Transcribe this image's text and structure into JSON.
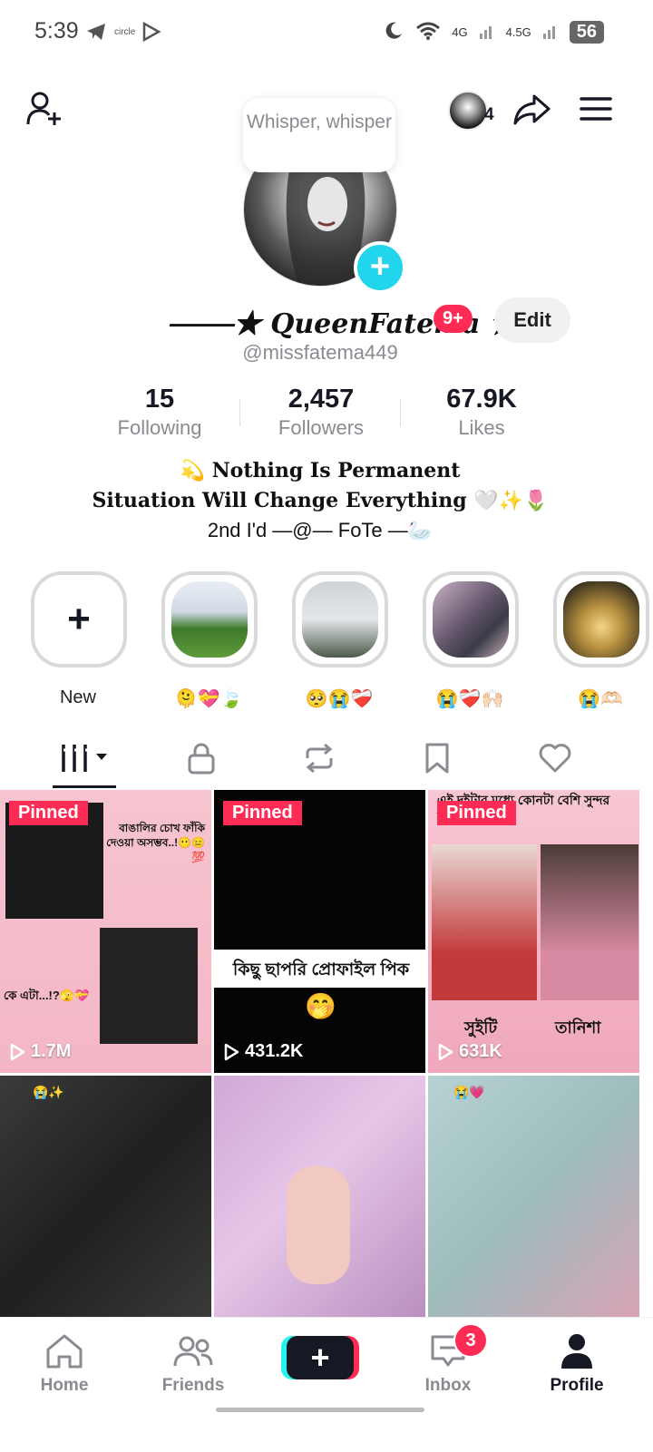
{
  "status_bar": {
    "time": "5:39",
    "network_1": "4G",
    "network_2": "4.5G",
    "battery": "56"
  },
  "header": {
    "bubble_text": "Whisper, whisper",
    "friends_count": "4"
  },
  "profile": {
    "display_name": "⸻★ QueenFatema ★",
    "notification_badge": "9+",
    "edit_label": "Edit",
    "username": "@missfatema449"
  },
  "stats": [
    {
      "value": "15",
      "label": "Following"
    },
    {
      "value": "2,457",
      "label": "Followers"
    },
    {
      "value": "67.9K",
      "label": "Likes"
    }
  ],
  "bio": {
    "line1": "💫 Nothing Is Permanent",
    "line2": "Situation Will Change Everything 🤍✨🌷",
    "line3": "2nd I'd —@— FoTe —🦢"
  },
  "highlights": [
    {
      "caption": "New"
    },
    {
      "caption": "🫠💝🍃"
    },
    {
      "caption": "🥺😭❤️‍🩹"
    },
    {
      "caption": "😭❤️‍🩹🙌🏻"
    },
    {
      "caption": "😭🫶🏻"
    }
  ],
  "videos": [
    {
      "pinned": "Pinned",
      "views": "1.7M",
      "overlay": "বাঙালির চোখ ফাঁকি দেওয়া অসম্ভব..!😶😑💯",
      "overlay2": "কে এটা...!?🫣💝"
    },
    {
      "pinned": "Pinned",
      "views": "431.2K",
      "overlay": "কিছু ছাপরি প্রোফাইল পিক",
      "overlay2": "🤭"
    },
    {
      "pinned": "Pinned",
      "views": "631K",
      "overlay": "এই দুইটার মধ্যে কোনটা বেশি সুন্দর হইছে??😩🎀",
      "overlay2": "সুইটি",
      "overlay3": "তানিশা"
    },
    {
      "pinned": "",
      "views": "",
      "overlay": "😭✨"
    },
    {
      "pinned": "",
      "views": "",
      "overlay": ""
    },
    {
      "pinned": "",
      "views": "",
      "overlay": "😭💗"
    }
  ],
  "nav": {
    "home": "Home",
    "friends": "Friends",
    "create": "+",
    "inbox": "Inbox",
    "inbox_badge": "3",
    "profile": "Profile"
  },
  "colors": {
    "accent_red": "#fe2c55",
    "accent_cyan": "#20d5ec",
    "text_secondary": "#8a8b91"
  }
}
